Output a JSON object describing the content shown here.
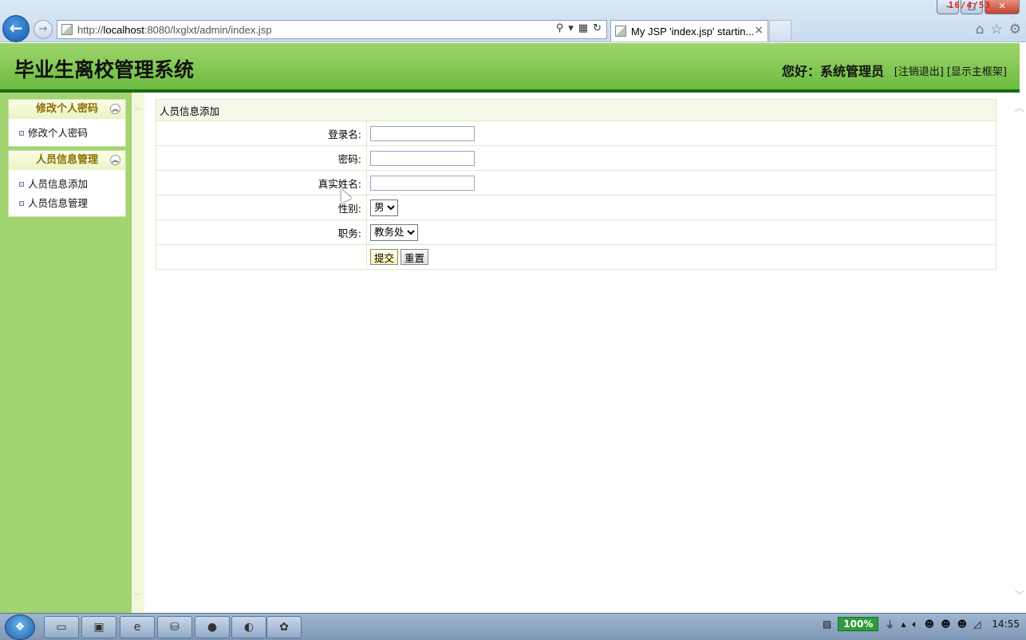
{
  "browser": {
    "url_prefix": "http://",
    "url_host": "localhost",
    "url_rest": ":8080/lxglxt/admin/index.jsp",
    "tab_title": "My JSP 'index.jsp' startin...",
    "tab_close": "×",
    "time_overlay": "16/4/53"
  },
  "header": {
    "title": "毕业生离校管理系统",
    "greeting": "您好：系统管理员",
    "logout_link": "[注销退出]",
    "show_frame_link": "[显示主框架]"
  },
  "sidebar": {
    "groups": [
      {
        "title": "修改个人密码",
        "items": [
          "修改个人密码"
        ]
      },
      {
        "title": "人员信息管理",
        "items": [
          "人员信息添加",
          "人员信息管理"
        ]
      }
    ]
  },
  "form": {
    "caption": "人员信息添加",
    "fields": [
      {
        "label": "登录名:",
        "value": ""
      },
      {
        "label": "密码:",
        "value": ""
      },
      {
        "label": "真实姓名:",
        "value": ""
      }
    ],
    "gender_label": "性别:",
    "gender_value": "男",
    "duty_label": "职务:",
    "duty_value": "教务处",
    "submit_label": "提交",
    "reset_label": "重置"
  },
  "taskbar": {
    "battery": "100%",
    "clock": "14:55"
  }
}
